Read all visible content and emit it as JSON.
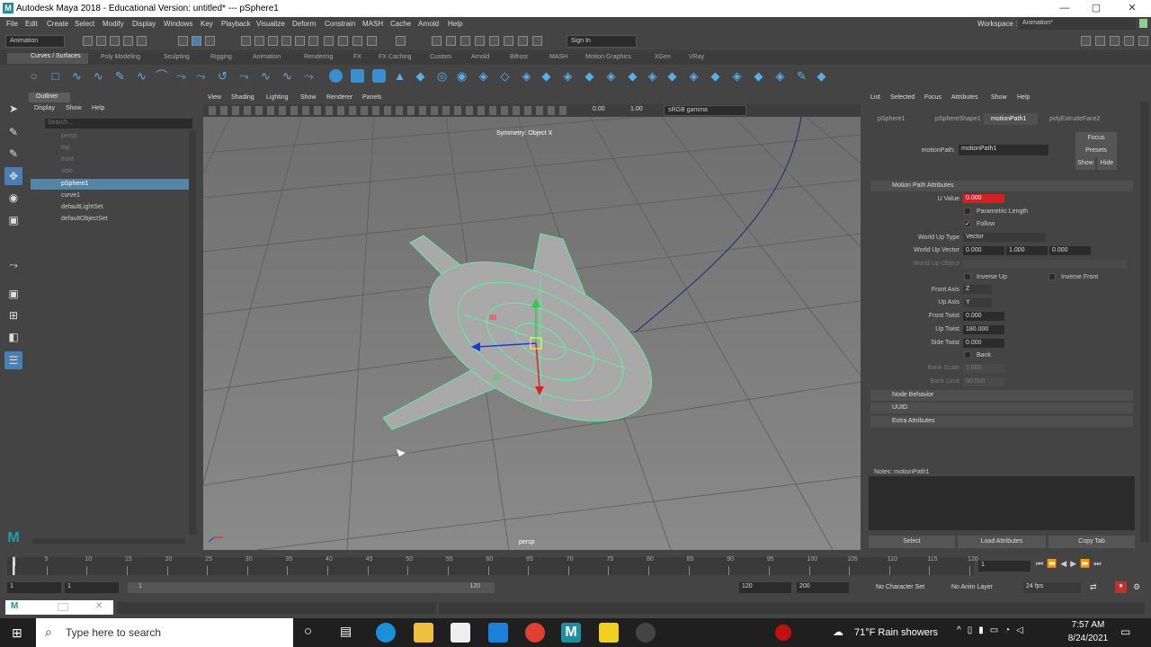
{
  "window": {
    "title": "Autodesk Maya 2018 - Educational Version: untitled*   ---   pSphere1",
    "minimize": "—",
    "maximize": "▢",
    "close": "✕"
  },
  "menu": [
    "File",
    "Edit",
    "Create",
    "Select",
    "Modify",
    "Display",
    "Windows",
    "Key",
    "Playback",
    "Visualize",
    "Deform",
    "Constrain",
    "MASH",
    "Cache",
    "Arnold",
    "Help"
  ],
  "workspace": {
    "label": "Workspace :",
    "value": "Animation*"
  },
  "status": {
    "mode": "Animation",
    "sign_in": "Sign In"
  },
  "shelf_tabs": [
    "Curves / Surfaces",
    "Poly Modeling",
    "Sculpting",
    "Rigging",
    "Animation",
    "Rendering",
    "FX",
    "FX Caching",
    "Custom",
    "Arnold",
    "Bifrost",
    "MASH",
    "Motion Graphics",
    "XGen",
    "VRay"
  ],
  "outliner": {
    "tab": "Outliner",
    "menu": [
      "Display",
      "Show",
      "Help"
    ],
    "search_placeholder": "Search...",
    "items": [
      {
        "label": "persp",
        "dim": true,
        "selected": false
      },
      {
        "label": "top",
        "dim": true,
        "selected": false
      },
      {
        "label": "front",
        "dim": true,
        "selected": false
      },
      {
        "label": "side",
        "dim": true,
        "selected": false
      },
      {
        "label": "pSphere1",
        "dim": false,
        "selected": true
      },
      {
        "label": "curve1",
        "dim": false,
        "selected": false
      },
      {
        "label": "defaultLightSet",
        "dim": false,
        "selected": false
      },
      {
        "label": "defaultObjectSet",
        "dim": false,
        "selected": false
      }
    ]
  },
  "viewport": {
    "menu": [
      "View",
      "Shading",
      "Lighting",
      "Show",
      "Renderer",
      "Panels"
    ],
    "exposure": "0.00",
    "gamma": "1.00",
    "colorspace": "sRGB gamma",
    "symmetry": "Symmetry: Object X",
    "camera": "persp"
  },
  "attribute_editor": {
    "menu": [
      "List",
      "Selected",
      "Focus",
      "Attributes",
      "Show",
      "Help"
    ],
    "tabs": [
      "pSphere1",
      "pSphereShape1",
      "motionPath1",
      "polyExtrudeFace2"
    ],
    "node_label": "motionPath:",
    "node_value": "motionPath1",
    "focus": "Focus",
    "presets": "Presets",
    "show": "Show",
    "hide": "Hide",
    "section_main": "Motion Path Attributes",
    "u_value_label": "U Value",
    "u_value": "0.000",
    "param_length": "Parametric Length",
    "follow": "Follow",
    "world_up_type_label": "World Up Type",
    "world_up_type": "Vector",
    "world_up_vector_label": "World Up Vector",
    "world_up_vector": [
      "0.000",
      "1.000",
      "0.000"
    ],
    "world_up_object_label": "World Up Object",
    "inverse_up": "Inverse Up",
    "inverse_front": "Inverse Front",
    "front_axis_label": "Front Axis",
    "front_axis": "Z",
    "up_axis_label": "Up Axis",
    "up_axis": "Y",
    "front_twist_label": "Front Twist",
    "front_twist": "0.000",
    "up_twist_label": "Up Twist",
    "up_twist": "180.000",
    "side_twist_label": "Side Twist",
    "side_twist": "0.000",
    "bank": "Bank",
    "bank_scale_label": "Bank Scale",
    "bank_scale": "1.000",
    "bank_limit_label": "Bank Limit",
    "bank_limit": "90.000",
    "sections": [
      "Node Behavior",
      "UUID",
      "Extra Attributes"
    ],
    "notes": "Notes:  motionPath1",
    "buttons": [
      "Select",
      "Load Attributes",
      "Copy Tab"
    ]
  },
  "timeline": {
    "ticks": [
      "1",
      "5",
      "10",
      "15",
      "20",
      "25",
      "30",
      "35",
      "40",
      "45",
      "50",
      "55",
      "60",
      "65",
      "70",
      "75",
      "80",
      "85",
      "90",
      "95",
      "100",
      "105",
      "110",
      "115",
      "120"
    ],
    "current": "1"
  },
  "range": {
    "start": "1",
    "start2": "1",
    "slider_start": "1",
    "slider_end": "120",
    "end": "120",
    "end2": "200",
    "char_set": "No Character Set",
    "anim_layer": "No Anim Layer",
    "fps": "24 fps"
  },
  "taskbar": {
    "search": "Type here to search",
    "weather": "71°F  Rain showers",
    "time": "7:57 AM",
    "date": "8/24/2021"
  }
}
